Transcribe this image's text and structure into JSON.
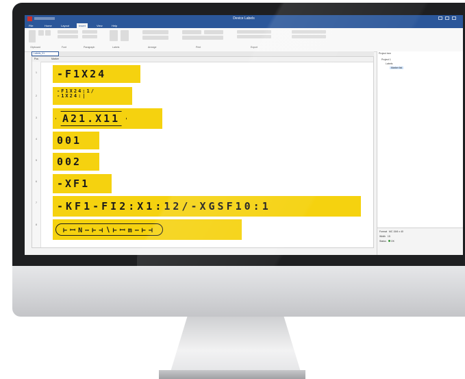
{
  "window": {
    "title": "Device Labels",
    "tabs": [
      "File",
      "Home",
      "Layout",
      "Insert",
      "View",
      "Help"
    ],
    "active_tab_index": 3
  },
  "ribbon": {
    "groups": [
      "Clipboard",
      "Font",
      "Paragraph",
      "Labels",
      "Arrange",
      "Print",
      "Export"
    ]
  },
  "document": {
    "tab_label": "Labels_01",
    "columns": [
      "Pos",
      "Marker"
    ],
    "rows": [
      {
        "num": "1",
        "text": "-F1X24",
        "style": "plain"
      },
      {
        "num": "2",
        "line1": "-F1X24:1/",
        "line2": "-1X24:|",
        "style": "small"
      },
      {
        "num": "3",
        "text": "A21.X11",
        "style": "hex"
      },
      {
        "num": "4",
        "text": "001",
        "style": "plain"
      },
      {
        "num": "5",
        "text": "002",
        "style": "plain"
      },
      {
        "num": "6",
        "text": "-XF1",
        "style": "plain"
      },
      {
        "num": "7",
        "text": "-KF1-FI2:X1:12/-XGSF10:1",
        "style": "plain"
      },
      {
        "num": "8",
        "text": "⊢ꟷN⋯⊢⊣∖⊢ꟷm⋯⊢⊣",
        "style": "pill"
      }
    ]
  },
  "right_pane": {
    "title": "Project tree",
    "tree": [
      "Project 1",
      "Labels",
      "Marker list"
    ],
    "properties": [
      {
        "key": "Format",
        "value": "MC 15/6 x 40"
      },
      {
        "key": "Width",
        "value": "15"
      },
      {
        "key": "Status",
        "value": "OK"
      }
    ]
  },
  "colors": {
    "marker_yellow": "#f5d20f",
    "titlebar_blue": "#2b579a",
    "bezel": "#1e1f21"
  }
}
